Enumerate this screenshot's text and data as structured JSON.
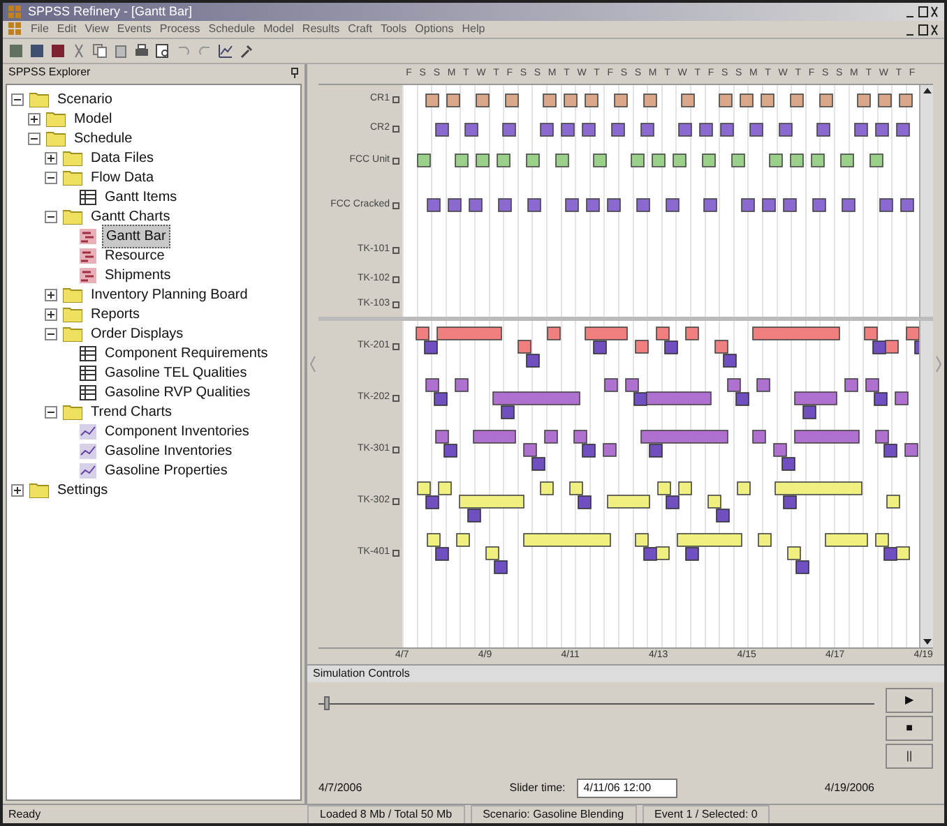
{
  "window": {
    "title": "SPPSS Refinery - [Gantt Bar]"
  },
  "menu": [
    "File",
    "Edit",
    "View",
    "Events",
    "Process",
    "Schedule",
    "Model",
    "Results",
    "Craft",
    "Tools",
    "Options",
    "Help"
  ],
  "explorer": {
    "title": "SPPSS Explorer",
    "tree": [
      {
        "label": "Scenario",
        "kind": "folder",
        "expanded": true,
        "selected": false,
        "children": [
          {
            "label": "Model",
            "kind": "folder",
            "expanded": false,
            "selected": false
          },
          {
            "label": "Schedule",
            "kind": "folder",
            "expanded": true,
            "selected": false,
            "children": [
              {
                "label": "Data Files",
                "kind": "folder",
                "expanded": false,
                "selected": false
              },
              {
                "label": "Flow Data",
                "kind": "folder",
                "expanded": true,
                "selected": false,
                "children": [
                  {
                    "label": "Gantt Items",
                    "kind": "table",
                    "selected": false
                  }
                ]
              },
              {
                "label": "Gantt Charts",
                "kind": "folder",
                "expanded": true,
                "selected": false,
                "children": [
                  {
                    "label": "Gantt Bar",
                    "kind": "gantt",
                    "selected": true
                  },
                  {
                    "label": "Resource",
                    "kind": "gantt",
                    "selected": false
                  },
                  {
                    "label": "Shipments",
                    "kind": "gantt",
                    "selected": false
                  }
                ]
              },
              {
                "label": "Inventory Planning Board",
                "kind": "folder",
                "expanded": false,
                "selected": false
              },
              {
                "label": "Reports",
                "kind": "folder",
                "expanded": false,
                "selected": false
              },
              {
                "label": "Order Displays",
                "kind": "folder",
                "expanded": true,
                "selected": false,
                "children": [
                  {
                    "label": "Component Requirements",
                    "kind": "table",
                    "selected": false
                  },
                  {
                    "label": "Gasoline TEL Qualities",
                    "kind": "table",
                    "selected": false
                  },
                  {
                    "label": "Gasoline RVP Qualities",
                    "kind": "table",
                    "selected": false
                  }
                ]
              },
              {
                "label": "Trend Charts",
                "kind": "folder",
                "expanded": true,
                "selected": false,
                "children": [
                  {
                    "label": "Component Inventories",
                    "kind": "trend",
                    "selected": false
                  },
                  {
                    "label": "Gasoline Inventories",
                    "kind": "trend",
                    "selected": false
                  },
                  {
                    "label": "Gasoline Properties",
                    "kind": "trend",
                    "selected": false
                  }
                ]
              }
            ]
          }
        ]
      },
      {
        "label": "Settings",
        "kind": "folder",
        "expanded": false,
        "selected": false
      }
    ]
  },
  "gantt": {
    "days": [
      "F",
      "S",
      "S",
      "M",
      "T",
      "W",
      "T",
      "F",
      "S",
      "S",
      "M",
      "T",
      "W",
      "T",
      "F",
      "S",
      "S",
      "M",
      "T",
      "W",
      "T",
      "F",
      "S",
      "S",
      "M",
      "T",
      "W",
      "T",
      "F",
      "S",
      "S",
      "M",
      "T",
      "W",
      "T",
      "F"
    ],
    "top_rows": [
      {
        "label": "CR1",
        "color": "#d9a88a"
      },
      {
        "label": "CR2",
        "color": "#8a6ad0"
      },
      {
        "label": "FCC Unit",
        "color": "#9ad08a"
      },
      {
        "label": "FCC Cracked",
        "color": "#8a6ad0"
      },
      {
        "label": "TK-101"
      },
      {
        "label": "TK-102"
      },
      {
        "label": "TK-103"
      }
    ],
    "bottom_rows": [
      {
        "label": "TK-201",
        "color": "#f08080"
      },
      {
        "label": "TK-202",
        "color": "#b070d0"
      },
      {
        "label": "TK-301",
        "color": "#b070d0"
      },
      {
        "label": "TK-302",
        "color": "#f0f080"
      },
      {
        "label": "TK-401",
        "color": "#f0f080"
      }
    ],
    "axis": [
      "4/7",
      "4/9",
      "4/11",
      "4/13",
      "4/15",
      "4/17",
      "4/19"
    ]
  },
  "simulation": {
    "title": "Simulation Controls",
    "level": 0.01,
    "start": "4/7/2006",
    "slider_label": "Slider time:",
    "slider_time": "4/11/06 12:00",
    "end": "4/19/2006",
    "buttons": [
      "▶",
      "■",
      "||"
    ]
  },
  "status_bar": [
    "Ready",
    "Loaded 8 Mb / Total 50 Mb",
    "Scenario: Gasoline Blending",
    "Event 1 / Selected: 0"
  ]
}
